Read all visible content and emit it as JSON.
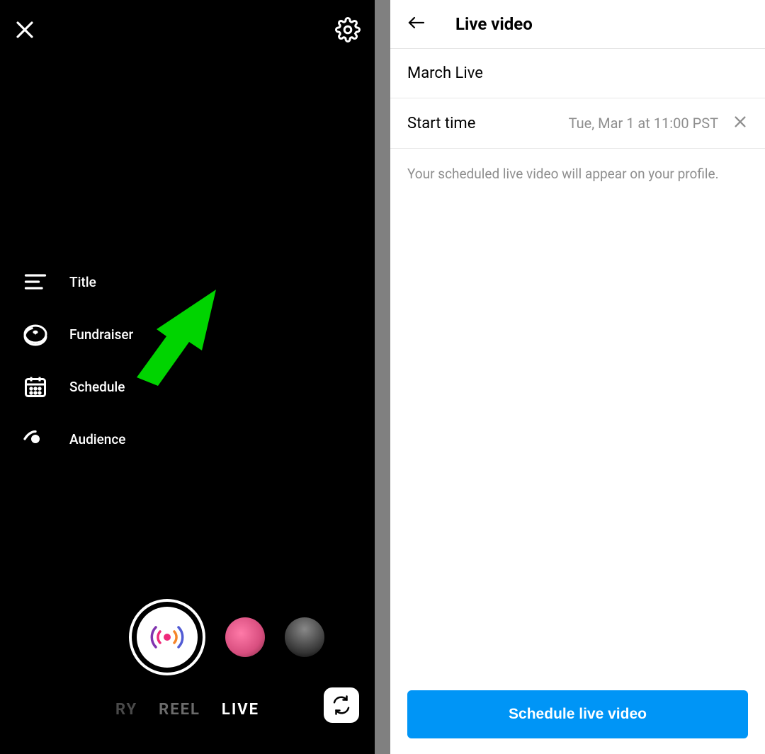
{
  "leftPanel": {
    "options": {
      "title": "Title",
      "fundraiser": "Fundraiser",
      "schedule": "Schedule",
      "audience": "Audience"
    },
    "modes": {
      "partial": "RY",
      "reel": "REEL",
      "live": "LIVE"
    }
  },
  "rightPanel": {
    "headerTitle": "Live video",
    "eventTitle": "March Live",
    "startTimeLabel": "Start time",
    "startTimeValue": "Tue, Mar 1 at 11:00 PST",
    "hint": "Your scheduled live video will appear on your profile.",
    "scheduleButton": "Schedule live video"
  }
}
